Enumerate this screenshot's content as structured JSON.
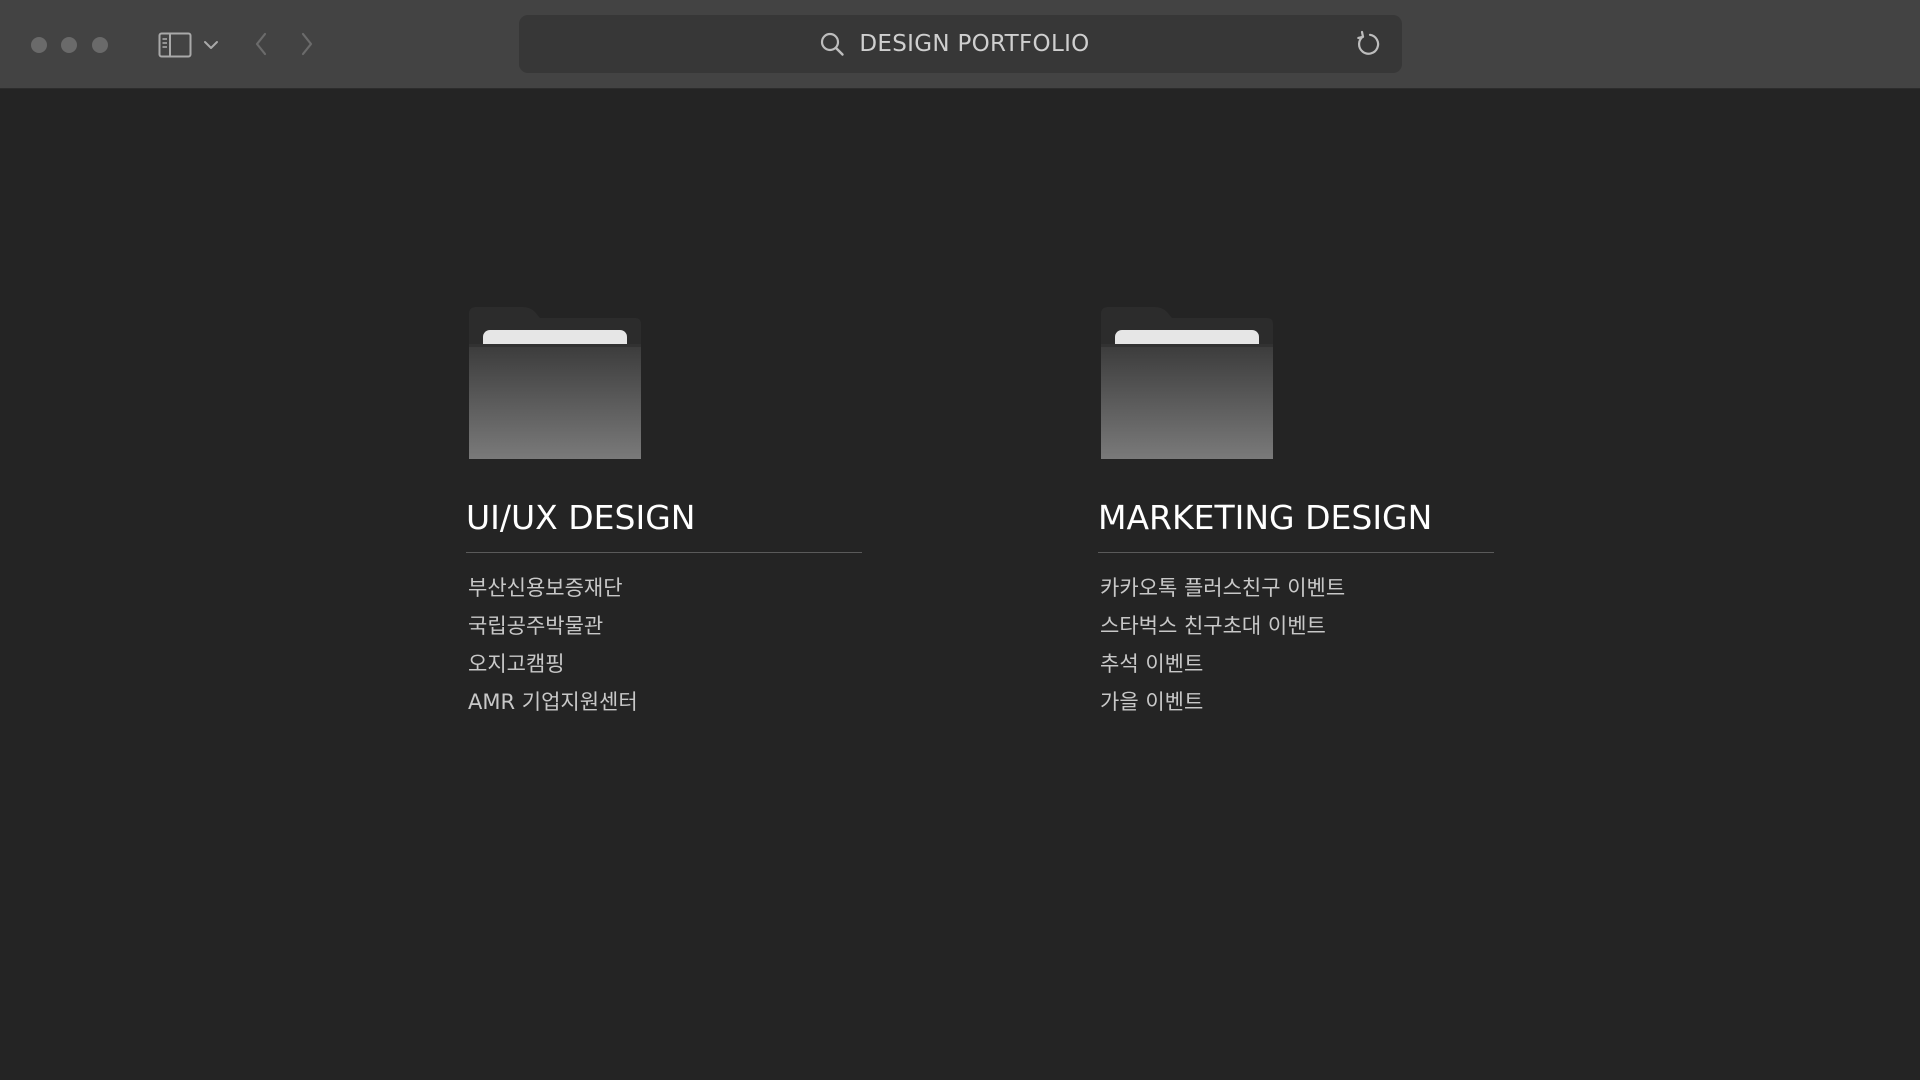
{
  "toolbar": {
    "address_text": "DESIGN PORTFOLIO",
    "icons": {
      "window_controls": [
        "close-dot",
        "minimize-dot",
        "zoom-dot"
      ],
      "sidebar": "sidebar-icon",
      "sidebar_menu": "chevron-down-icon",
      "back": "chevron-left-icon",
      "forward": "chevron-right-icon",
      "search": "search-icon",
      "reload": "reload-icon"
    }
  },
  "folders": [
    {
      "title": "UI/UX DESIGN",
      "items": [
        "부산신용보증재단",
        "국립공주박물관",
        "오지고캠핑",
        "AMR 기업지원센터"
      ]
    },
    {
      "title": "MARKETING DESIGN",
      "items": [
        "카카오톡 플러스친구 이벤트",
        "스타벅스 친구초대 이벤트",
        "추석 이벤트",
        "가을 이벤트"
      ]
    }
  ],
  "colors": {
    "background": "#242424",
    "toolbar": "#434343",
    "address_bar": "#373737",
    "text_primary": "#ffffff",
    "text_secondary": "#c8c8c8"
  }
}
